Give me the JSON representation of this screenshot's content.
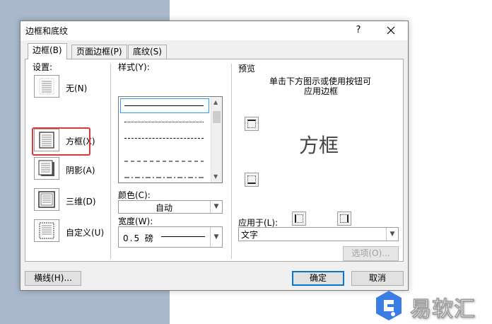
{
  "dialog": {
    "title": "边框和底纹",
    "help": "?",
    "tabs": [
      {
        "label": "边框(B)"
      },
      {
        "label": "页面边框(P)"
      },
      {
        "label": "底纹(S)"
      }
    ],
    "active_tab": 0
  },
  "settings": {
    "heading": "设置:",
    "items": [
      {
        "label": "无(N)",
        "icon": "border-none-icon"
      },
      {
        "label": "方框(X)",
        "icon": "border-box-icon"
      },
      {
        "label": "阴影(A)",
        "icon": "border-shadow-icon"
      },
      {
        "label": "三维(D)",
        "icon": "border-3d-icon"
      },
      {
        "label": "自定义(U)",
        "icon": "border-custom-icon"
      }
    ],
    "selected": 1
  },
  "style": {
    "heading": "样式(Y):",
    "lines": [
      "solid",
      "dotted",
      "dashed-fine",
      "dashed",
      "dash-dot"
    ]
  },
  "color": {
    "label": "颜色(C):",
    "value": "自动"
  },
  "width": {
    "label": "宽度(W):",
    "value": "0.5 磅"
  },
  "preview": {
    "heading": "预览",
    "hint_line1": "单击下方图示或使用按钮可",
    "hint_line2": "应用边框",
    "sample_text": "方框"
  },
  "apply_to": {
    "label": "应用于(L):",
    "value": "文字",
    "options_button": "选项(O)..."
  },
  "footer": {
    "horizontal_line": "横线(H)...",
    "ok": "确定",
    "cancel": "取消"
  },
  "watermark": {
    "text": "易软汇",
    "color": "#3a7ee4"
  },
  "colors": {
    "highlight": "#d9393e",
    "accent": "#0078d7"
  }
}
